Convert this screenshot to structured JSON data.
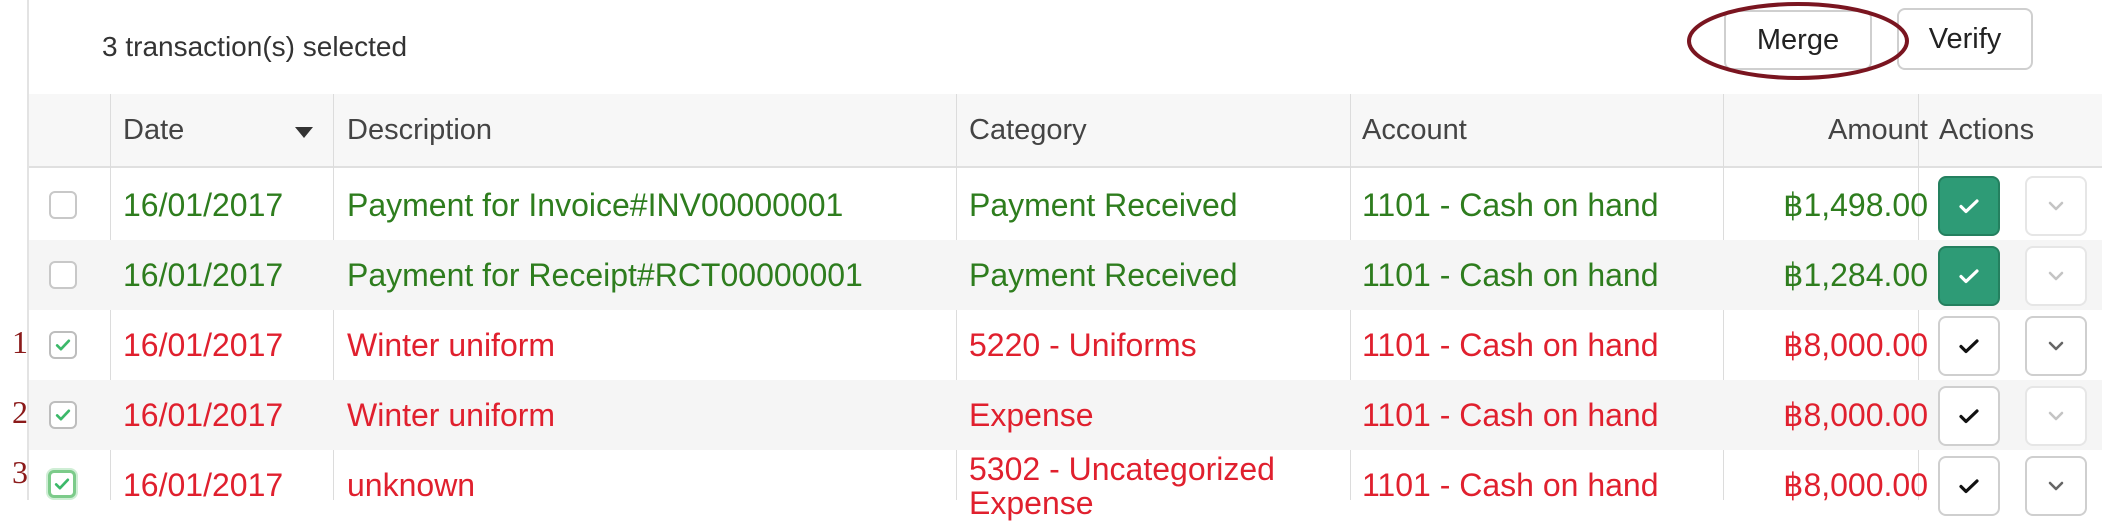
{
  "toolbar": {
    "selected_text": "3 transaction(s) selected",
    "merge_label": "Merge",
    "verify_label": "Verify"
  },
  "table": {
    "headers": {
      "date": "Date",
      "description": "Description",
      "category": "Category",
      "account": "Account",
      "amount": "Amount",
      "actions": "Actions"
    },
    "sort": {
      "column": "Date",
      "direction": "descending"
    },
    "rows": [
      {
        "checked": false,
        "date": "16/01/2017",
        "description": "Payment for Invoice#INV00000001",
        "category": "Payment Received",
        "account": "1101 - Cash on hand",
        "amount": "฿1,498.00",
        "status": "verified"
      },
      {
        "checked": false,
        "date": "16/01/2017",
        "description": "Payment for Receipt#RCT00000001",
        "category": "Payment Received",
        "account": "1101 - Cash on hand",
        "amount": "฿1,284.00",
        "status": "verified"
      },
      {
        "checked": true,
        "marker": "1",
        "date": "16/01/2017",
        "description": "Winter uniform",
        "category": "5220 - Uniforms",
        "account": "1101 - Cash on hand",
        "amount": "฿8,000.00",
        "status": "unverified"
      },
      {
        "checked": true,
        "marker": "2",
        "date": "16/01/2017",
        "description": "Winter uniform",
        "category": "Expense",
        "account": "1101 - Cash on hand",
        "amount": "฿8,000.00",
        "status": "unverified"
      },
      {
        "checked": true,
        "marker": "3",
        "date": "16/01/2017",
        "description": "unknown",
        "category": "5302 - Uncategorized Expense",
        "account": "1101 - Cash on hand",
        "amount": "฿8,000.00",
        "status": "unverified"
      }
    ]
  },
  "colors": {
    "income": "#2e7d1e",
    "expense": "#e0202e",
    "verified_button": "#2e9b76",
    "annotation": "#8b1a1a"
  },
  "icons": [
    "check-icon",
    "chevron-down-icon",
    "sort-caret-icon"
  ]
}
